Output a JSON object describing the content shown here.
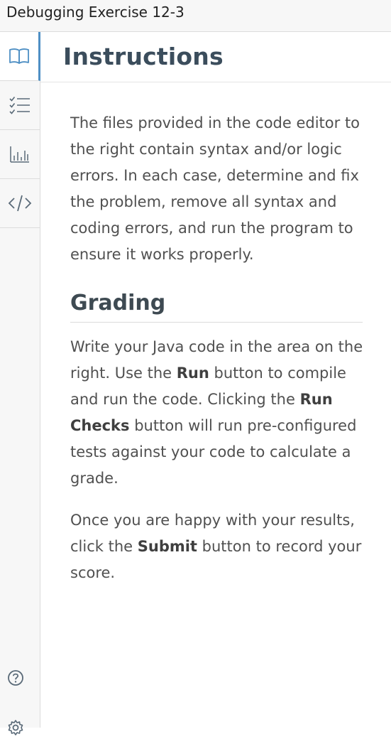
{
  "window": {
    "title": "Debugging Exercise 12-3"
  },
  "sidebar": {
    "items": [
      {
        "name": "instructions",
        "icon": "book-icon",
        "active": true
      },
      {
        "name": "checklist",
        "icon": "checklist-icon",
        "active": false
      },
      {
        "name": "grades",
        "icon": "bar-chart-icon",
        "active": false
      },
      {
        "name": "code",
        "icon": "code-icon",
        "active": false
      }
    ],
    "bottom_icons": [
      "help-icon",
      "gear-icon"
    ]
  },
  "colors": {
    "accent": "#4e8fc4",
    "heading": "#3b4d5c",
    "body_text": "#505050",
    "sidebar_bg": "#f7f7f7"
  },
  "main": {
    "title": "Instructions",
    "intro": "The files provided in the code editor to the right contain syntax and/or logic errors. In each case, determine and fix the problem, remove all syntax and coding errors, and run the program to ensure it works properly.",
    "grading_heading": "Grading",
    "grading_text": {
      "part1": "Write your Java code in the area on the right. Use the ",
      "run_label": "Run",
      "part2": " button to compile and run the code. Clicking the ",
      "run_checks_label": "Run Checks",
      "part3": " button will run pre-configured tests against your code to calculate a grade."
    },
    "submit_text": {
      "part1": "Once you are happy with your results, click the ",
      "submit_label": "Submit",
      "part2": " button to record your score."
    }
  }
}
